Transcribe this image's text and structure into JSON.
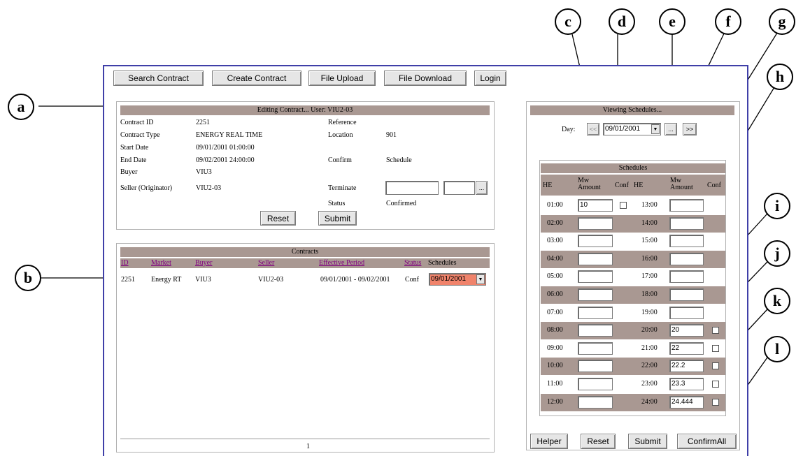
{
  "toolbar": {
    "search": "Search Contract",
    "create": "Create Contract",
    "upload": "File Upload",
    "download": "File Download",
    "login": "Login"
  },
  "editing": {
    "header": "Editing Contract... User: VIU2-03",
    "contract_id_label": "Contract ID",
    "contract_id": "2251",
    "reference_label": "Reference",
    "contract_type_label": "Contract Type",
    "contract_type": "ENERGY REAL TIME",
    "location_label": "Location",
    "location": "901",
    "start_date_label": "Start Date",
    "start_date": "09/01/2001 01:00:00",
    "end_date_label": "End Date",
    "end_date": "09/02/2001 24:00:00",
    "confirm_label": "Confirm",
    "confirm": "Schedule",
    "buyer_label": "Buyer",
    "buyer": "VIU3",
    "seller_label": "Seller (Originator)",
    "seller": "VIU2-03",
    "terminate_label": "Terminate",
    "terminate_button": "...",
    "status_label": "Status",
    "status": "Confirmed",
    "reset": "Reset",
    "submit": "Submit"
  },
  "contracts": {
    "header": "Contracts",
    "columns": [
      "ID",
      "Market",
      "Buyer",
      "Seller",
      "Effective Period",
      "Status",
      "Schedules"
    ],
    "row": {
      "id": "2251",
      "market": "Energy RT",
      "buyer": "VIU3",
      "seller": "VIU2-03",
      "period": "09/01/2001 - 09/02/2001",
      "status": "Conf",
      "schedule": "09/01/2001"
    },
    "page_number": "1"
  },
  "viewing": {
    "header": "Viewing Schedules...",
    "day_label": "Day:",
    "prev": "<<",
    "date": "09/01/2001",
    "dots": "...",
    "next": ">>"
  },
  "schedules": {
    "header": "Schedules",
    "col_he": "HE",
    "col_mw_line1": "Mw",
    "col_mw_line2": "Amount",
    "col_conf": "Conf",
    "rows": [
      {
        "he1": "01:00",
        "mw1": "10",
        "he2": "13:00",
        "mw2": ""
      },
      {
        "he1": "02:00",
        "mw1": "",
        "he2": "14:00",
        "mw2": ""
      },
      {
        "he1": "03:00",
        "mw1": "",
        "he2": "15:00",
        "mw2": ""
      },
      {
        "he1": "04:00",
        "mw1": "",
        "he2": "16:00",
        "mw2": ""
      },
      {
        "he1": "05:00",
        "mw1": "",
        "he2": "17:00",
        "mw2": ""
      },
      {
        "he1": "06:00",
        "mw1": "",
        "he2": "18:00",
        "mw2": ""
      },
      {
        "he1": "07:00",
        "mw1": "",
        "he2": "19:00",
        "mw2": ""
      },
      {
        "he1": "08:00",
        "mw1": "",
        "he2": "20:00",
        "mw2": "20"
      },
      {
        "he1": "09:00",
        "mw1": "",
        "he2": "21:00",
        "mw2": "22"
      },
      {
        "he1": "10:00",
        "mw1": "",
        "he2": "22:00",
        "mw2": "22.2"
      },
      {
        "he1": "11:00",
        "mw1": "",
        "he2": "23:00",
        "mw2": "23.3"
      },
      {
        "he1": "12:00",
        "mw1": "",
        "he2": "24:00",
        "mw2": "24.444"
      }
    ]
  },
  "bottom": {
    "helper": "Helper",
    "reset": "Reset",
    "submit": "Submit",
    "confirm_all": "ConfirmAll"
  },
  "callouts": [
    "a",
    "b",
    "c",
    "d",
    "e",
    "f",
    "g",
    "h",
    "i",
    "j",
    "k",
    "l"
  ]
}
